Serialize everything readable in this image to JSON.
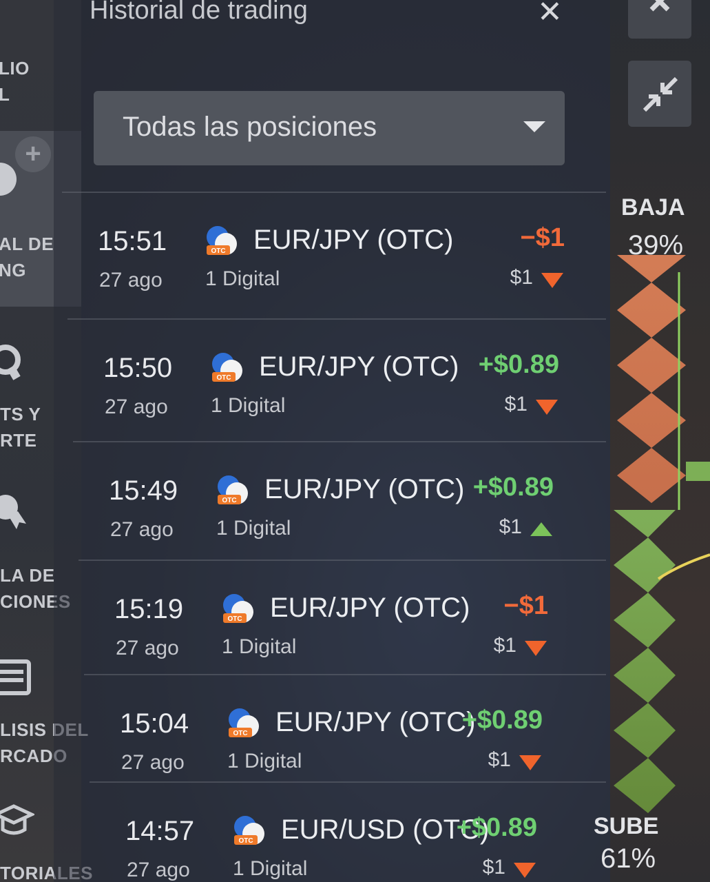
{
  "panel": {
    "title": "Historial de trading",
    "close_icon": "close-icon",
    "filter": {
      "selected": "Todas las posiciones"
    }
  },
  "sidebar": {
    "items": [
      {
        "line1": "LIO",
        "line2": "L"
      },
      {
        "line1": "AL DE",
        "line2": "NG"
      },
      {
        "line1": "TS Y",
        "line2": "RTE"
      },
      {
        "line1": "LA DE",
        "line2": "CIONES"
      },
      {
        "line1": "LISIS DEL",
        "line2": "RCADO"
      },
      {
        "line1": "TORIALES",
        "line2": ""
      }
    ],
    "add_label": "+"
  },
  "trades": [
    {
      "time": "15:51",
      "date": "27 ago",
      "pair": "EUR/JPY (OTC)",
      "type": "1 Digital",
      "result": "−$1",
      "amount": "$1",
      "direction": "down",
      "outcome": "loss"
    },
    {
      "time": "15:50",
      "date": "27 ago",
      "pair": "EUR/JPY (OTC)",
      "type": "1 Digital",
      "result": "+$0.89",
      "amount": "$1",
      "direction": "down",
      "outcome": "win"
    },
    {
      "time": "15:49",
      "date": "27 ago",
      "pair": "EUR/JPY (OTC)",
      "type": "1 Digital",
      "result": "+$0.89",
      "amount": "$1",
      "direction": "up",
      "outcome": "win"
    },
    {
      "time": "15:19",
      "date": "27 ago",
      "pair": "EUR/JPY (OTC)",
      "type": "1 Digital",
      "result": "−$1",
      "amount": "$1",
      "direction": "down",
      "outcome": "loss"
    },
    {
      "time": "15:04",
      "date": "27 ago",
      "pair": "EUR/JPY (OTC)",
      "type": "1 Digital",
      "result": "+$0.89",
      "amount": "$1",
      "direction": "down",
      "outcome": "win"
    },
    {
      "time": "14:57",
      "date": "27 ago",
      "pair": "EUR/USD (OTC)",
      "type": "1 Digital",
      "result": "+$0.89",
      "amount": "$1",
      "direction": "down",
      "outcome": "win"
    }
  ],
  "sentiment": {
    "down_label": "BAJA",
    "down_pct": "39%",
    "up_label": "SUBE",
    "up_pct": "61%"
  },
  "colors": {
    "win": "#6fcf72",
    "loss": "#f26a3a",
    "down_arrow": "#f0642c",
    "up_arrow": "#7cc35a"
  }
}
